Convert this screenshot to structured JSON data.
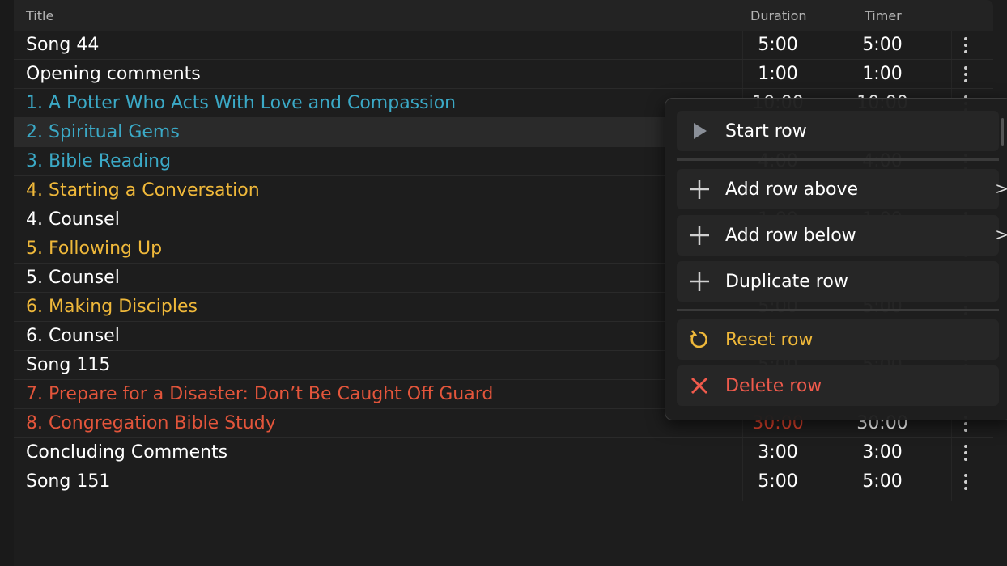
{
  "header": {
    "title": "Title",
    "duration": "Duration",
    "timer": "Timer"
  },
  "rows": [
    {
      "title": "Song 44",
      "duration": "5:00",
      "timer": "5:00",
      "color": "#ffffff"
    },
    {
      "title": "Opening comments",
      "duration": "1:00",
      "timer": "1:00",
      "color": "#ffffff"
    },
    {
      "title": "1. A Potter Who Acts With Love and Compassion",
      "duration": "10:00",
      "timer": "10:00",
      "color": "#3ba9c6"
    },
    {
      "title": "2. Spiritual Gems",
      "duration": "10:00",
      "timer": "10:00",
      "color": "#3ba9c6"
    },
    {
      "title": "3. Bible Reading",
      "duration": "4:00",
      "timer": "4:00",
      "color": "#3ba9c6"
    },
    {
      "title": "4. Starting a Conversation",
      "duration": "2:00",
      "timer": "2:00",
      "color": "#efb83a"
    },
    {
      "title": "4. Counsel",
      "duration": "1:00",
      "timer": "1:00",
      "color": "#ffffff"
    },
    {
      "title": "5. Following Up",
      "duration": "4:00",
      "timer": "4:00",
      "color": "#efb83a"
    },
    {
      "title": "5. Counsel",
      "duration": "1:00",
      "timer": "1:00",
      "color": "#ffffff"
    },
    {
      "title": "6. Making Disciples",
      "duration": "5:00",
      "timer": "5:00",
      "color": "#efb83a"
    },
    {
      "title": "6. Counsel",
      "duration": "1:00",
      "timer": "1:00",
      "color": "#ffffff"
    },
    {
      "title": "Song 115",
      "duration": "5:00",
      "timer": "5:00",
      "color": "#ffffff"
    },
    {
      "title": "7. Prepare for a Disaster: Don’t Be Caught Off Guard",
      "duration": "15:00",
      "timer": "15:00",
      "color": "#e3553b"
    },
    {
      "title": "8. Congregation Bible Study",
      "duration": "30:00",
      "timer": "30:00",
      "color": "#e3553b",
      "duration_color": "#e0412b"
    },
    {
      "title": "Concluding Comments",
      "duration": "3:00",
      "timer": "3:00",
      "color": "#ffffff"
    },
    {
      "title": "Song 151",
      "duration": "5:00",
      "timer": "5:00",
      "color": "#ffffff"
    }
  ],
  "highlighted_row": 3,
  "context_menu": {
    "start": "Start row",
    "add_above": "Add row above",
    "add_below": "Add row below",
    "duplicate": "Duplicate row",
    "reset": "Reset row",
    "delete": "Delete row",
    "submenu_chevron": ">",
    "reset_color": "#efb83a",
    "delete_color": "#ef5a4c"
  }
}
